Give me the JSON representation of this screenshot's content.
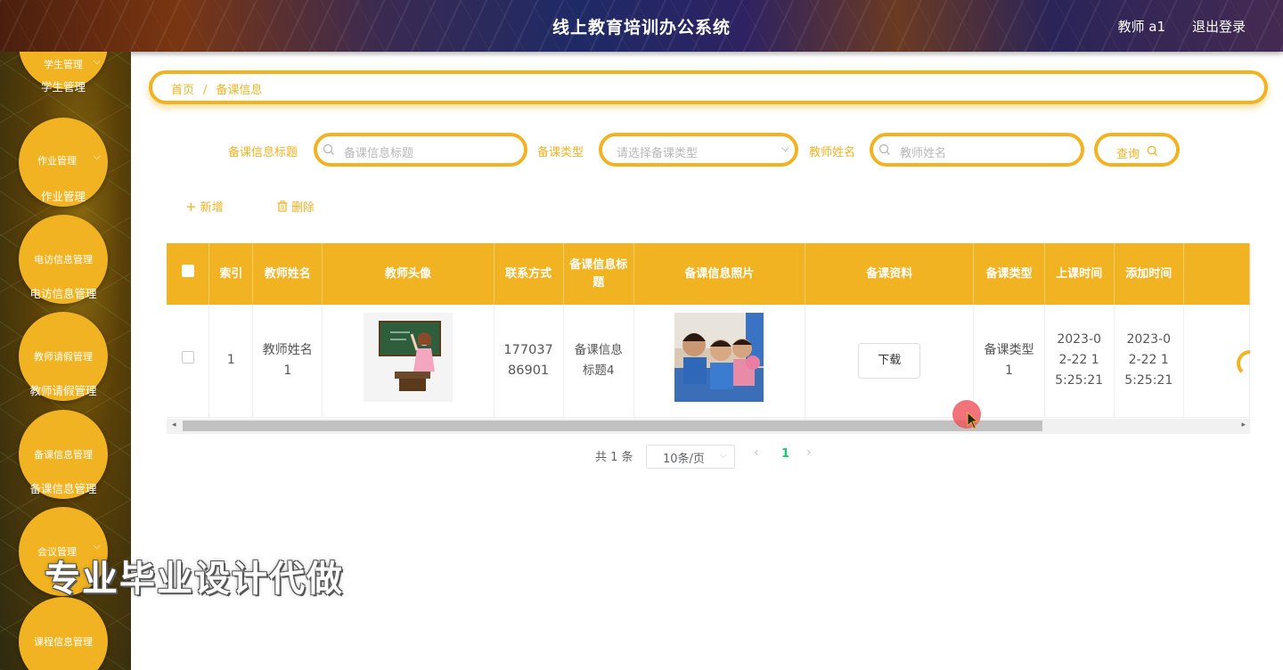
{
  "header": {
    "title": "线上教育培训办公系统",
    "user": "教师 a1",
    "logout": "退出登录"
  },
  "sidebar": {
    "items": [
      {
        "label": "学生管理",
        "sub": "学生管理"
      },
      {
        "label": "作业管理",
        "sub": "作业管理"
      },
      {
        "label": "电访信息管理",
        "sub": "电访信息管理"
      },
      {
        "label": "教师请假管理",
        "sub": "教师请假管理"
      },
      {
        "label": "备课信息管理",
        "sub": "备课信息管理"
      },
      {
        "label": "会议管理",
        "sub": ""
      },
      {
        "label": "课程信息管理",
        "sub": ""
      }
    ]
  },
  "breadcrumb": {
    "home": "首页",
    "sep": "/",
    "current": "备课信息"
  },
  "search": {
    "title_label": "备课信息标题",
    "title_placeholder": "备课信息标题",
    "type_label": "备课类型",
    "type_placeholder": "请选择备课类型",
    "teacher_label": "教师姓名",
    "teacher_placeholder": "教师姓名",
    "query": "查询"
  },
  "actions": {
    "add": "新增",
    "delete": "删除"
  },
  "table": {
    "headers": [
      "索引",
      "教师姓名",
      "教师头像",
      "联系方式",
      "备课信息标题",
      "备课信息照片",
      "备课资料",
      "备课类型",
      "上课时间",
      "添加时间"
    ],
    "rows": [
      {
        "index": "1",
        "teacher_name": "教师姓名1",
        "phone": "17703786901",
        "title": "备课信息标题4",
        "material_button": "下载",
        "type": "备课类型1",
        "class_time": "2023-02-22 15:25:21",
        "add_time": "2023-02-22 15:25:21"
      }
    ]
  },
  "pagination": {
    "total": "共 1 条",
    "page_size": "10条/页",
    "current_page": "1"
  },
  "watermark": "专业毕业设计代做",
  "colors": {
    "accent": "#f2b322",
    "header_bg": "#2e2262",
    "active_page": "#13ce66"
  }
}
